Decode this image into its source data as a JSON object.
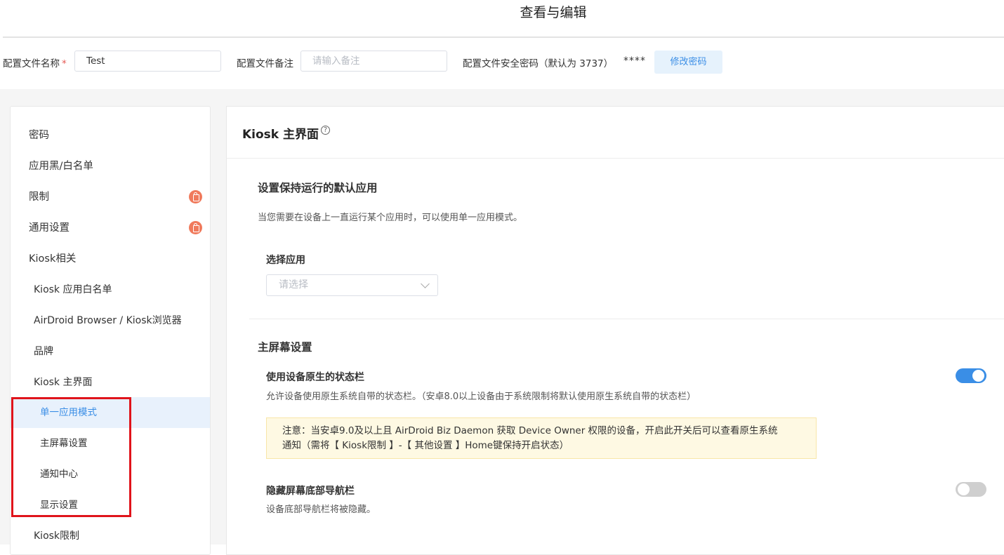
{
  "page": {
    "title": "查看与编辑"
  },
  "profile_form": {
    "name_label": "配置文件名称",
    "required_mark": "*",
    "name_value": "Test",
    "remark_label": "配置文件备注",
    "remark_placeholder": "请输入备注",
    "password_label": "配置文件安全密码（默认为 3737）",
    "password_mask": "****",
    "change_password_button": "修改密码"
  },
  "sidebar": {
    "items": [
      {
        "label": "密码",
        "level": 0,
        "locked": false
      },
      {
        "label": "应用黑/白名单",
        "level": 0,
        "locked": false
      },
      {
        "label": "限制",
        "level": 0,
        "locked": true
      },
      {
        "label": "通用设置",
        "level": 0,
        "locked": true
      },
      {
        "label": "Kiosk相关",
        "level": 0,
        "locked": false
      },
      {
        "label": "Kiosk 应用白名单",
        "level": 1,
        "locked": false
      },
      {
        "label": "AirDroid Browser / Kiosk浏览器",
        "level": 1,
        "locked": false
      },
      {
        "label": "品牌",
        "level": 1,
        "locked": false
      },
      {
        "label": "Kiosk 主界面",
        "level": 1,
        "locked": false
      },
      {
        "label": "单一应用模式",
        "level": 2,
        "locked": false,
        "active": true
      },
      {
        "label": "主屏幕设置",
        "level": 2,
        "locked": false
      },
      {
        "label": "通知中心",
        "level": 2,
        "locked": false
      },
      {
        "label": "显示设置",
        "level": 2,
        "locked": false
      },
      {
        "label": "Kiosk限制",
        "level": 1,
        "locked": false
      }
    ]
  },
  "content": {
    "title": "Kiosk 主界面",
    "help_glyph": "?",
    "single_app": {
      "title": "设置保持运行的默认应用",
      "description": "当您需要在设备上一直运行某个应用时，可以使用单一应用模式。",
      "select_label": "选择应用",
      "select_placeholder": "请选择"
    },
    "home_screen": {
      "title": "主屏幕设置",
      "native_status_bar": {
        "title": "使用设备原生的状态栏",
        "description": "允许设备使用原生系统自带的状态栏。（安卓8.0以上设备由于系统限制将默认使用原生系统自带的状态栏）",
        "enabled": true,
        "note_line1": "注意：当安卓9.0及以上且 AirDroid Biz Daemon 获取 Device Owner 权限的设备，开启此开关后可以查看原生系统",
        "note_line2": "通知（需将【 Kiosk限制 】-【 其他设置 】Home键保持开启状态）"
      },
      "hide_nav_bar": {
        "title": "隐藏屏幕底部导航栏",
        "description": "设备底部导航栏将被隐藏。",
        "enabled": false
      }
    }
  },
  "colors": {
    "accent": "#3a8ee6",
    "highlight_box": "#e0141b",
    "lock_badge": "#f07a5c",
    "note_background": "#fef9e3"
  }
}
